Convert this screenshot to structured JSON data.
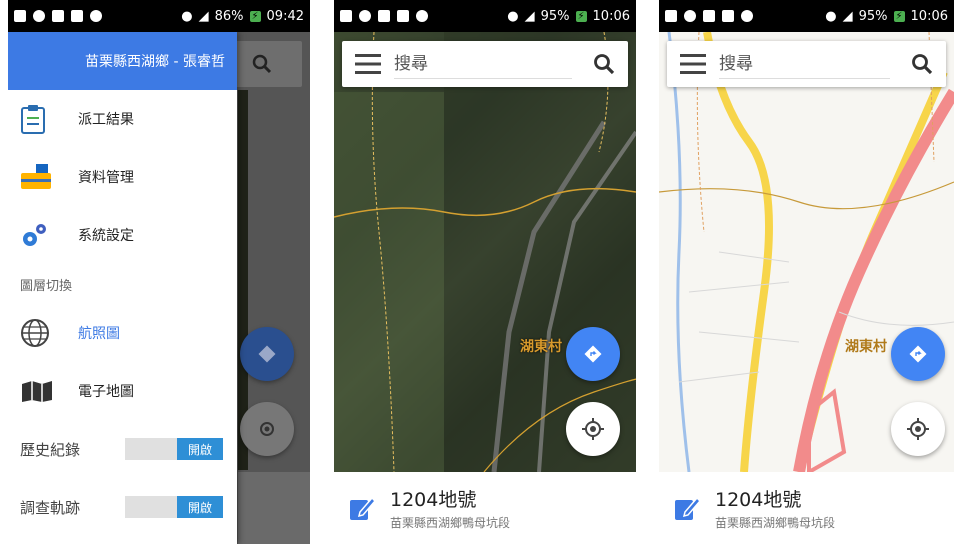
{
  "status_bars": [
    {
      "battery": "86%",
      "time": "09:42"
    },
    {
      "battery": "95%",
      "time": "10:06"
    },
    {
      "battery": "95%",
      "time": "10:06"
    }
  ],
  "drawer": {
    "header": "苗栗縣西湖鄉 - 張睿哲",
    "items": [
      {
        "label": "派工結果",
        "icon": "clipboard-icon"
      },
      {
        "label": "資料管理",
        "icon": "toolbox-icon"
      },
      {
        "label": "系統設定",
        "icon": "gears-icon"
      }
    ],
    "layer_section": "圖層切換",
    "layers": [
      {
        "label": "航照圖",
        "icon": "globe-icon",
        "active": true
      },
      {
        "label": "電子地圖",
        "icon": "map-icon",
        "active": false
      }
    ],
    "toggles": [
      {
        "label": "歷史紀錄",
        "state": "開啟"
      },
      {
        "label": "調查軌跡",
        "state": "開啟"
      }
    ]
  },
  "search": {
    "placeholder": "搜尋"
  },
  "map_label": "湖東村",
  "card": {
    "title": "1204地號",
    "subtitle": "苗栗縣西湖鄉鴨母坑段"
  },
  "colors": {
    "accent": "#4285f4",
    "drawer_header": "#3d7ae4",
    "toggle_on": "#2e8fd6"
  }
}
